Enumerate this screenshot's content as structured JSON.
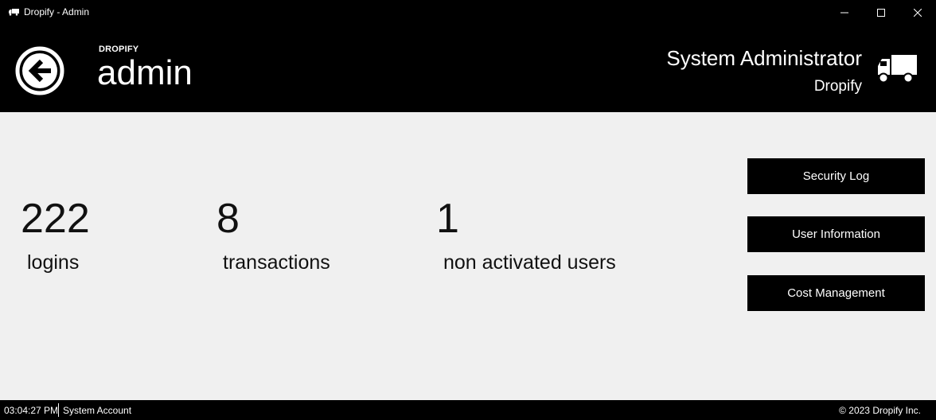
{
  "window": {
    "title": "Dropify - Admin"
  },
  "header": {
    "brand_small": "DROPIFY",
    "brand_big": "admin",
    "user_name": "System Administrator",
    "user_org": "Dropify"
  },
  "stats": [
    {
      "value": "222",
      "label": "logins"
    },
    {
      "value": "8",
      "label": "transactions"
    },
    {
      "value": "1",
      "label": "non activated users"
    }
  ],
  "buttons": {
    "security_log": "Security Log",
    "user_information": "User Information",
    "cost_management": "Cost Management"
  },
  "statusbar": {
    "time": "03:04:27 PM",
    "account": "System Account",
    "copyright": "© 2023 Dropify Inc."
  },
  "colors": {
    "chrome": "#000000",
    "content_bg": "#f0f0f0",
    "text_light": "#ffffff",
    "text_dark": "#111111"
  },
  "icons": {
    "app": "truck-icon",
    "back": "back-arrow-circle-icon",
    "header_logo": "truck-icon"
  }
}
